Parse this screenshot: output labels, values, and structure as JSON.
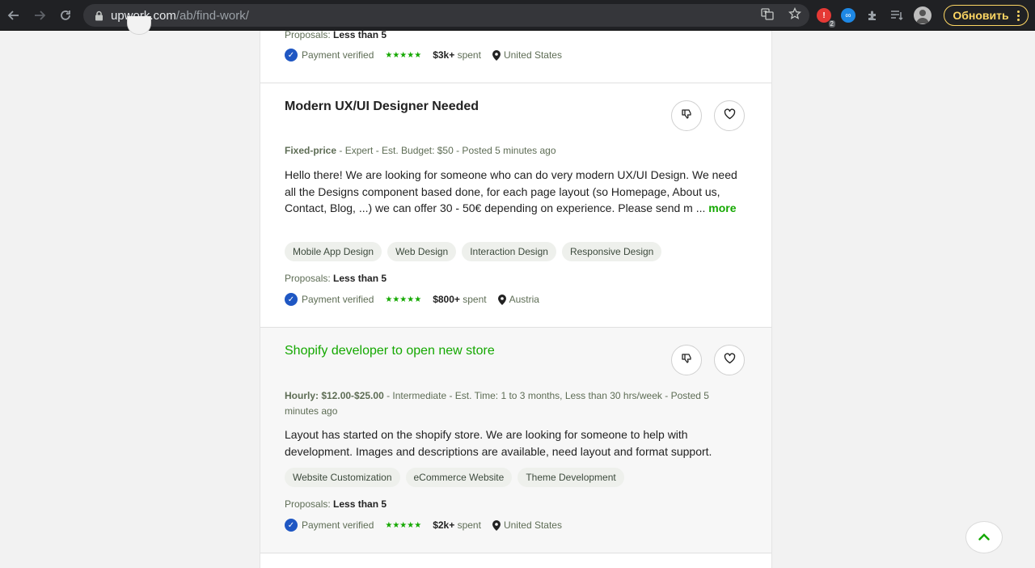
{
  "browser": {
    "url_host": "upwork.com",
    "url_path": "/ab/find-work/",
    "update_label": "Обновить",
    "ext_badge": "2"
  },
  "top_partial": {
    "proposals_label": "Proposals:",
    "proposals_value": "Less than 5",
    "verified": "Payment verified",
    "spent_amount": "$3k+",
    "spent_label": "spent",
    "location": "United States"
  },
  "jobs": [
    {
      "title": "Modern UX/UI Designer Needed",
      "type": "Fixed-price",
      "info_rest": " - Expert - Est. Budget: $50 - Posted 5 minutes ago",
      "description": "Hello there! We are looking for someone who can do very modern UX/UI Design. We need all the Designs component based done, for each page layout (so Homepage, About us, Contact, Blog, ...) we can offer 30 - 50€ depending on experience. Please send m ...",
      "more": "more",
      "tags": [
        "Mobile App Design",
        "Web Design",
        "Interaction Design",
        "Responsive Design"
      ],
      "proposals_label": "Proposals:",
      "proposals_value": "Less than 5",
      "verified": "Payment verified",
      "spent_amount": "$800+",
      "spent_label": "spent",
      "location": "Austria"
    },
    {
      "title": "Shopify developer to open new store",
      "type": "Hourly: $12.00-$25.00",
      "info_rest": " - Intermediate - Est. Time: 1 to 3 months, Less than 30 hrs/week - Posted 5 minutes ago",
      "description": "Layout has started on the shopify store. We are looking for someone to help with development. Images and descriptions are available, need layout and format support.",
      "tags": [
        "Website Customization",
        "eCommerce Website",
        "Theme Development"
      ],
      "proposals_label": "Proposals:",
      "proposals_value": "Less than 5",
      "verified": "Payment verified",
      "spent_amount": "$2k+",
      "spent_label": "spent",
      "location": "United States"
    }
  ],
  "stars_glyph": "★★★★★",
  "colors": {
    "accent_green": "#14a800",
    "verified_blue": "#1f57c3",
    "chrome_dark": "#202124",
    "update_yellow": "#fdd663"
  },
  "icons": [
    "back-arrow-icon",
    "forward-arrow-icon",
    "reload-icon",
    "lock-icon",
    "translate-icon",
    "star-icon",
    "extension-icon",
    "reading-list-icon",
    "profile-avatar-icon",
    "kebab-menu-icon",
    "thumbs-down-icon",
    "heart-icon",
    "location-pin-icon",
    "verified-check-icon",
    "chevron-up-icon"
  ]
}
